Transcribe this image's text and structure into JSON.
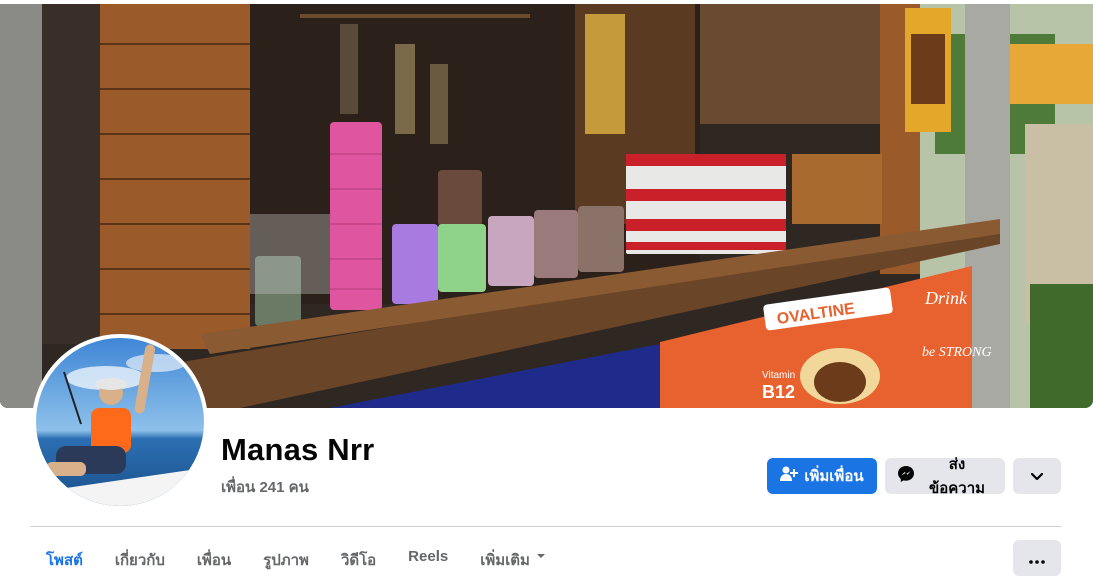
{
  "profile": {
    "name": "Manas Nrr",
    "friends_count": "เพื่อน 241 คน"
  },
  "cover": {
    "sign_brand": "OVALTINE",
    "sign_drink": "Drink",
    "sign_vitamin": "Vitamin",
    "sign_b12": "B12",
    "sign_strong": "be STRONG"
  },
  "actions": {
    "add_friend_label": "เพิ่มเพื่อน",
    "message_label": "ส่งข้อความ",
    "add_friend_icon": "person-plus-icon",
    "message_icon": "messenger-icon",
    "more_icon": "chevron-down-icon"
  },
  "tabs": [
    {
      "label": "โพสต์",
      "active": true
    },
    {
      "label": "เกี่ยวกับ",
      "active": false
    },
    {
      "label": "เพื่อน",
      "active": false
    },
    {
      "label": "รูปภาพ",
      "active": false
    },
    {
      "label": "วิดีโอ",
      "active": false
    },
    {
      "label": "Reels",
      "active": false
    },
    {
      "label": "เพิ่มเติม",
      "active": false
    }
  ],
  "tab_more_icon": "ellipsis-icon",
  "colors": {
    "primary": "#1b74e4",
    "secondary_button": "#e4e6eb",
    "muted_text": "#65676b"
  }
}
